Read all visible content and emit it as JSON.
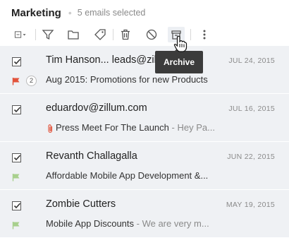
{
  "header": {
    "folder": "Marketing",
    "selected": "5 emails selected"
  },
  "toolbar": {
    "tooltip": "Archive"
  },
  "emails": [
    {
      "sender": "Tim Hanson... leads@zillum.com",
      "date": "JUL 24, 2015",
      "subject": "Aug 2015: Promotions for new Products",
      "preview": "",
      "count": "2",
      "flag_color": "#e2533b"
    },
    {
      "sender": "eduardov@zillum.com",
      "date": "JUL 16, 2015",
      "subject": "Press Meet For The Launch",
      "preview": " - Hey Pa...",
      "flag_color": ""
    },
    {
      "sender": "Revanth Challagalla",
      "date": "JUN 22, 2015",
      "subject": "Affordable Mobile App Development &...",
      "preview": "",
      "flag_color": "#a8d08d"
    },
    {
      "sender": "Zombie Cutters",
      "date": "MAY 19, 2015",
      "subject": "Mobile App Discounts",
      "preview": " - We are very m...",
      "flag_color": "#a8d08d"
    }
  ]
}
